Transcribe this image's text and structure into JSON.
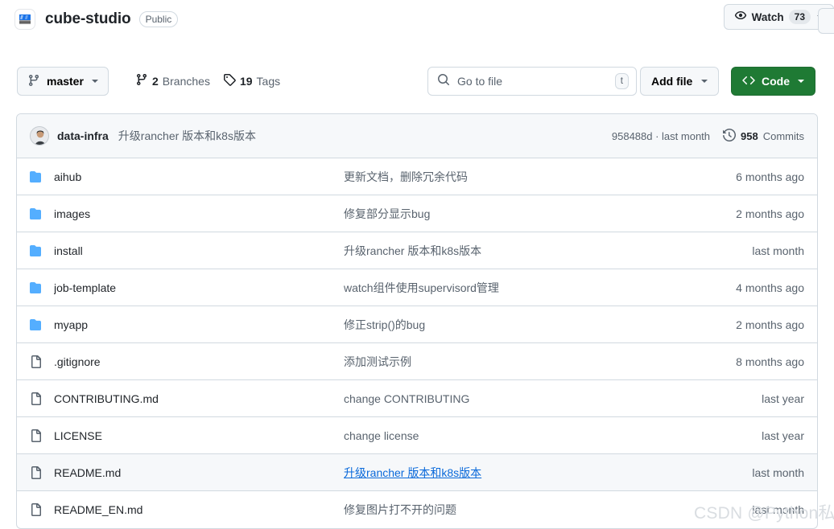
{
  "header": {
    "repo_name": "cube-studio",
    "visibility": "Public",
    "logo_icon": "repo-logo-icon",
    "watch": {
      "label": "Watch",
      "count": "73",
      "icon": "eye-icon"
    }
  },
  "toolbar": {
    "branch": {
      "name": "master",
      "icon": "git-branch-icon"
    },
    "branches": {
      "count": "2",
      "label": "Branches",
      "icon": "git-branch-icon"
    },
    "tags": {
      "count": "19",
      "label": "Tags",
      "icon": "tag-icon"
    },
    "search": {
      "placeholder": "Go to file",
      "shortcut": "t",
      "icon": "search-icon"
    },
    "add_file": "Add file",
    "code": {
      "label": "Code",
      "icon": "code-brackets-icon"
    }
  },
  "commit_bar": {
    "author": "data-infra",
    "message": "升级rancher 版本和k8s版本",
    "hash_and_time": "958488d · last month",
    "commits_count": "958",
    "commits_label": "Commits",
    "history_icon": "history-clock-icon",
    "avatar_icon": "avatar"
  },
  "files": [
    {
      "type": "folder",
      "name": "aihub",
      "message": "更新文档，删除冗余代码",
      "time": "6 months ago",
      "hovered": false,
      "link": false
    },
    {
      "type": "folder",
      "name": "images",
      "message": "修复部分显示bug",
      "time": "2 months ago",
      "hovered": false,
      "link": false
    },
    {
      "type": "folder",
      "name": "install",
      "message": "升级rancher 版本和k8s版本",
      "time": "last month",
      "hovered": false,
      "link": false
    },
    {
      "type": "folder",
      "name": "job-template",
      "message": "watch组件使用supervisord管理",
      "time": "4 months ago",
      "hovered": false,
      "link": false
    },
    {
      "type": "folder",
      "name": "myapp",
      "message": "修正strip()的bug",
      "time": "2 months ago",
      "hovered": false,
      "link": false
    },
    {
      "type": "file",
      "name": ".gitignore",
      "message": "添加测试示例",
      "time": "8 months ago",
      "hovered": false,
      "link": false
    },
    {
      "type": "file",
      "name": "CONTRIBUTING.md",
      "message": "change CONTRIBUTING",
      "time": "last year",
      "hovered": false,
      "link": false
    },
    {
      "type": "file",
      "name": "LICENSE",
      "message": "change license",
      "time": "last year",
      "hovered": false,
      "link": false
    },
    {
      "type": "file",
      "name": "README.md",
      "message": "升级rancher 版本和k8s版本",
      "time": "last month",
      "hovered": true,
      "link": true
    },
    {
      "type": "file",
      "name": "README_EN.md",
      "message": "修复图片打不开的问题",
      "time": "last month",
      "hovered": false,
      "link": false
    }
  ],
  "watermark": "CSDN @Python私教",
  "colors": {
    "accent_blue": "#0969da",
    "code_green": "#1f7a34",
    "folder_blue": "#54aeff",
    "border": "#d1d9e0",
    "muted_text": "#59636e",
    "canvas_subtle": "#f6f8fa"
  }
}
